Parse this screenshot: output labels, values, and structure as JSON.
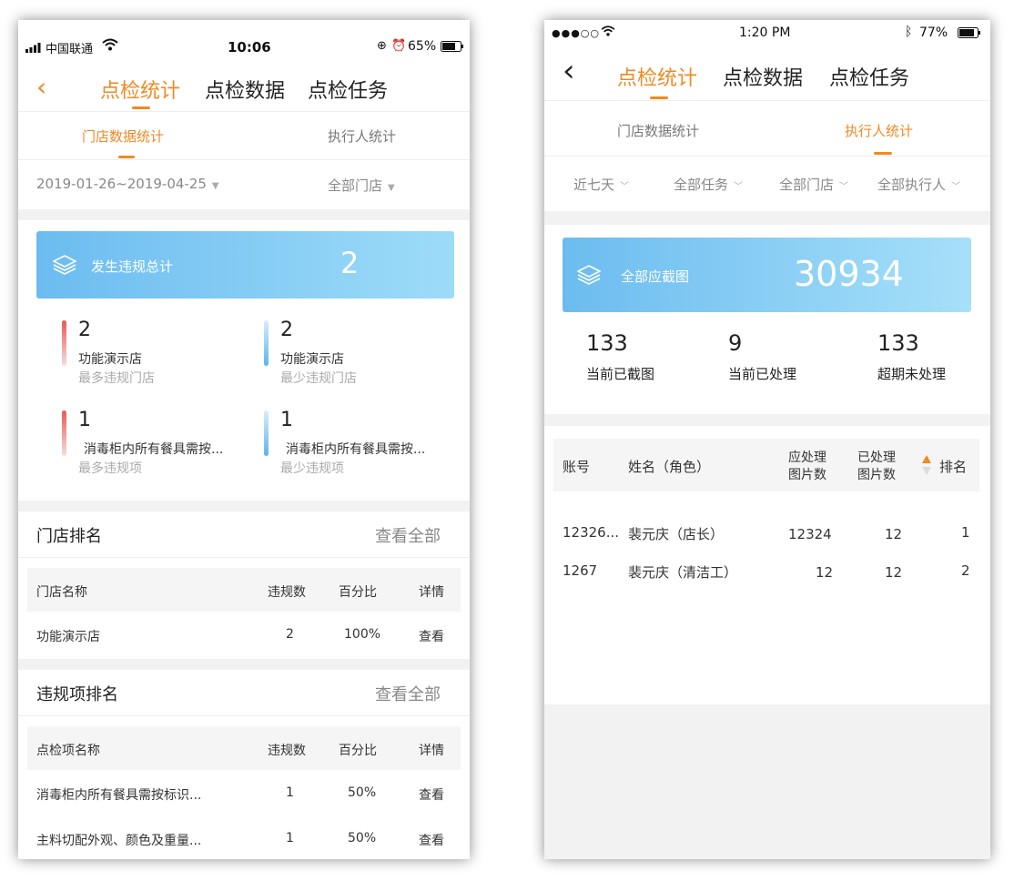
{
  "left": {
    "status": {
      "carrier": "中国联通",
      "time": "10:06",
      "battery": "65%"
    },
    "nav": {
      "back": "‹",
      "tabs": [
        "点检统计",
        "点检数据",
        "点检任务"
      ]
    },
    "subtabs": [
      "门店数据统计",
      "执行人统计"
    ],
    "filters": {
      "date_range": "2019-01-26~2019-04-25",
      "store": "全部门店"
    },
    "banner": {
      "label": "发生违规总计",
      "value": "2"
    },
    "stats": [
      {
        "num": "2",
        "name": "功能演示店",
        "sub": "最多违规门店"
      },
      {
        "num": "2",
        "name": "功能演示店",
        "sub": "最少违规门店"
      },
      {
        "num": "1",
        "name": "消毒柜内所有餐具需按...",
        "sub": "最多违规项"
      },
      {
        "num": "1",
        "name": "消毒柜内所有餐具需按...",
        "sub": "最少违规项"
      }
    ],
    "store_rank": {
      "title": "门店排名",
      "more": "查看全部",
      "headers": [
        "门店名称",
        "违规数",
        "百分比",
        "详情"
      ],
      "rows": [
        [
          "功能演示店",
          "2",
          "100%",
          "查看"
        ]
      ]
    },
    "item_rank": {
      "title": "违规项排名",
      "more": "查看全部",
      "headers": [
        "点检项名称",
        "违规数",
        "百分比",
        "详情"
      ],
      "rows": [
        [
          "消毒柜内所有餐具需按标识...",
          "1",
          "50%",
          "查看"
        ],
        [
          "主料切配外观、颜色及重量...",
          "1",
          "50%",
          "查看"
        ]
      ]
    }
  },
  "right": {
    "status": {
      "time": "1:20 PM",
      "battery": "77%"
    },
    "nav": {
      "back": "‹",
      "tabs": [
        "点检统计",
        "点检数据",
        "点检任务"
      ]
    },
    "subtabs": [
      "门店数据统计",
      "执行人统计"
    ],
    "filters": [
      "近七天",
      "全部任务",
      "全部门店",
      "全部执行人"
    ],
    "banner": {
      "label": "全部应截图",
      "value": "30934"
    },
    "stats": [
      {
        "num": "133",
        "label": "当前已截图"
      },
      {
        "num": "9",
        "label": "当前已处理"
      },
      {
        "num": "133",
        "label": "超期未处理"
      }
    ],
    "table": {
      "headers": {
        "account": "账号",
        "name": "姓名（角色）",
        "to_process_1": "应处理",
        "to_process_2": "图片数",
        "processed_1": "已处理",
        "processed_2": "图片数",
        "rank": "排名"
      },
      "rows": [
        {
          "account": "12326...",
          "name": "裴元庆（店长）",
          "to_process": "12324",
          "processed": "12",
          "rank": "1"
        },
        {
          "account": "1267",
          "name": "裴元庆（清洁工）",
          "to_process": "12",
          "processed": "12",
          "rank": "2"
        }
      ]
    }
  }
}
